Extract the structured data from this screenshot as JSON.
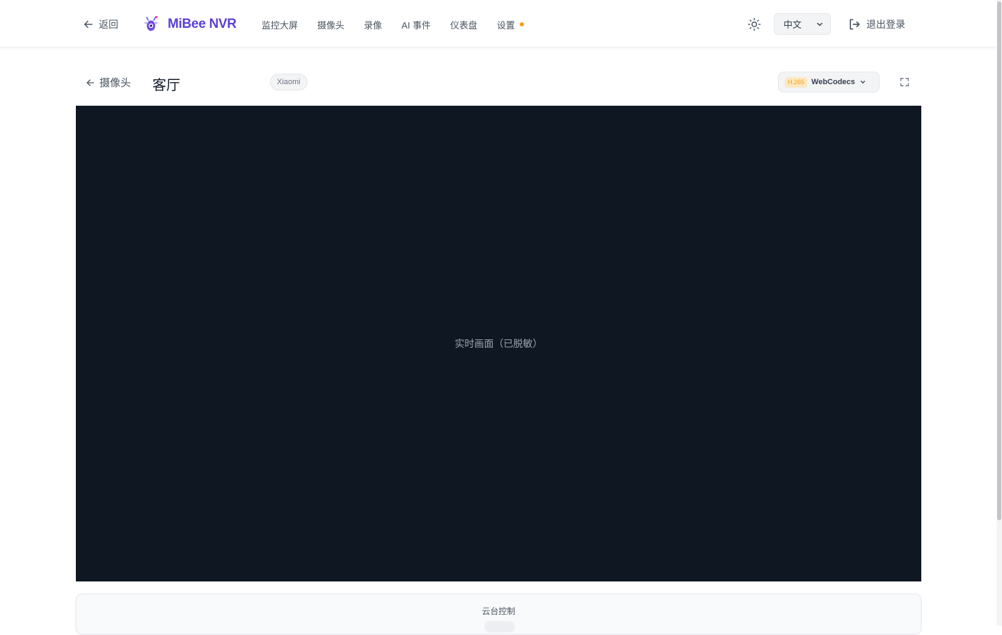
{
  "header": {
    "back_label": "返回",
    "brand_name": "MiBee NVR",
    "nav": [
      {
        "label": "监控大屏"
      },
      {
        "label": "摄像头"
      },
      {
        "label": "录像"
      },
      {
        "label": "AI 事件"
      },
      {
        "label": "仪表盘"
      },
      {
        "label": "设置",
        "has_dot": true
      }
    ],
    "language": "中文",
    "logout_label": "退出登录",
    "accent_color": "#5b3fd6",
    "dot_color": "#f59e0b"
  },
  "camera": {
    "back_label": "摄像头",
    "title": "客厅",
    "brand_badge": "Xiaomi",
    "codec_tag": "H.265",
    "decoder": "WebCodecs"
  },
  "video": {
    "placeholder": "实时画面（已脱敏）",
    "background": "#0f1723"
  },
  "ptz": {
    "title": "云台控制"
  }
}
